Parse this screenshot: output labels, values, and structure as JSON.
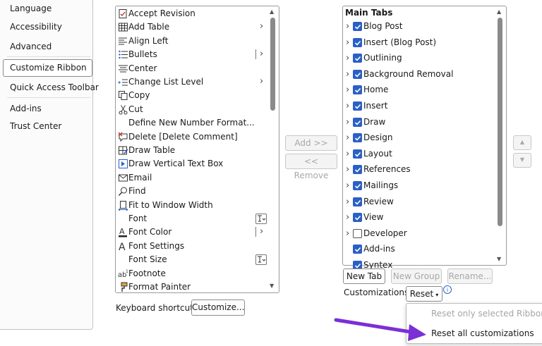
{
  "nav": {
    "items": [
      {
        "id": "language",
        "label": "Language"
      },
      {
        "id": "accessibility",
        "label": "Accessibility"
      },
      {
        "id": "advanced",
        "label": "Advanced"
      },
      {
        "id": "customize-ribbon",
        "label": "Customize Ribbon",
        "selected": true
      },
      {
        "id": "quick-access-toolbar",
        "label": "Quick Access Toolbar"
      },
      {
        "id": "add-ins",
        "label": "Add-ins"
      },
      {
        "id": "trust-center",
        "label": "Trust Center"
      }
    ]
  },
  "commands": [
    {
      "label": "Accept Revision",
      "icon": "accept-revision-icon"
    },
    {
      "label": "Add Table",
      "icon": "table-icon",
      "submenu": true
    },
    {
      "label": "Align Left",
      "icon": "align-left-icon"
    },
    {
      "label": "Bullets",
      "icon": "bullets-icon",
      "split": true
    },
    {
      "label": "Center",
      "icon": "align-center-icon"
    },
    {
      "label": "Change List Level",
      "icon": "list-level-icon",
      "submenu": true
    },
    {
      "label": "Copy",
      "icon": "copy-icon"
    },
    {
      "label": "Cut",
      "icon": "cut-icon"
    },
    {
      "label": "Define New Number Format...",
      "icon": ""
    },
    {
      "label": "Delete [Delete Comment]",
      "icon": "delete-comment-icon"
    },
    {
      "label": "Draw Table",
      "icon": "draw-table-icon"
    },
    {
      "label": "Draw Vertical Text Box",
      "icon": "vertical-textbox-icon"
    },
    {
      "label": "Email",
      "icon": "email-icon"
    },
    {
      "label": "Find",
      "icon": "find-icon"
    },
    {
      "label": "Fit to Window Width",
      "icon": "fit-width-icon"
    },
    {
      "label": "Font",
      "icon": "",
      "fontbox": true
    },
    {
      "label": "Font Color",
      "icon": "font-color-icon",
      "split": true
    },
    {
      "label": "Font Settings",
      "icon": "font-settings-icon"
    },
    {
      "label": "Font Size",
      "icon": "",
      "fontbox": true
    },
    {
      "label": "Footnote",
      "icon": "footnote-icon"
    },
    {
      "label": "Format Painter",
      "icon": "format-painter-icon"
    }
  ],
  "add_button": "Add >>",
  "remove_button": "<< Remove",
  "tabs": {
    "header": "Main Tabs",
    "items": [
      {
        "label": "Blog Post",
        "checked": true,
        "expandable": true
      },
      {
        "label": "Insert (Blog Post)",
        "checked": true,
        "expandable": true
      },
      {
        "label": "Outlining",
        "checked": true,
        "expandable": true
      },
      {
        "label": "Background Removal",
        "checked": true,
        "expandable": true
      },
      {
        "label": "Home",
        "checked": true,
        "expandable": true
      },
      {
        "label": "Insert",
        "checked": true,
        "expandable": true
      },
      {
        "label": "Draw",
        "checked": true,
        "expandable": true
      },
      {
        "label": "Design",
        "checked": true,
        "expandable": true
      },
      {
        "label": "Layout",
        "checked": true,
        "expandable": true
      },
      {
        "label": "References",
        "checked": true,
        "expandable": true
      },
      {
        "label": "Mailings",
        "checked": true,
        "expandable": true
      },
      {
        "label": "Review",
        "checked": true,
        "expandable": true
      },
      {
        "label": "View",
        "checked": true,
        "expandable": true
      },
      {
        "label": "Developer",
        "checked": false,
        "expandable": true
      },
      {
        "label": "Add-ins",
        "checked": true,
        "expandable": false
      },
      {
        "label": "Syntex",
        "checked": true,
        "expandable": false
      }
    ]
  },
  "new_tab_button": "New Tab",
  "new_group_button": "New Group",
  "rename_button": "Rename...",
  "customizations_label": "Customizations:",
  "reset_button": "Reset",
  "keyboard_shortcuts_label": "Keyboard shortcuts:",
  "customize_button": "Customize...",
  "reset_menu": {
    "selected_only": "Reset only selected Ribbon tab",
    "all": "Reset all customizations"
  },
  "colors": {
    "checkbox": "#2a5fc8",
    "annotation_arrow": "#7b2fd6",
    "info_icon": "#2a62c9"
  }
}
